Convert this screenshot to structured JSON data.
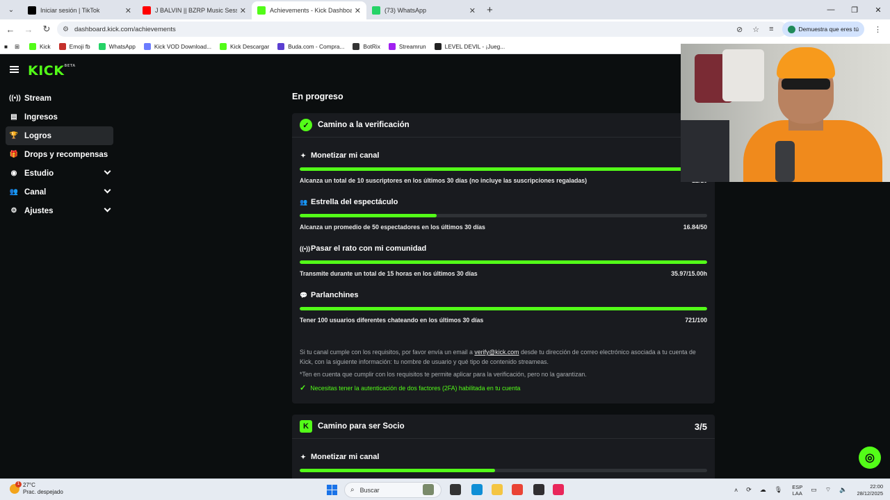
{
  "browser": {
    "tabs": [
      {
        "title": "Iniciar sesión | TikTok",
        "favicon_color": "#000000",
        "active": false
      },
      {
        "title": "J BALVIN || BZRP Music Session",
        "favicon_color": "#ff0000",
        "active": false
      },
      {
        "title": "Achievements - Kick Dashboard",
        "favicon_color": "#53fc18",
        "active": true
      },
      {
        "title": "(73) WhatsApp",
        "favicon_color": "#25d366",
        "active": false
      }
    ],
    "url": "dashboard.kick.com/achievements",
    "verify_chip": "Demuestra que eres tú",
    "bookmarks": [
      {
        "label": "Kick",
        "color": "#53fc18"
      },
      {
        "label": "Emoji fb",
        "color": "#c4302b"
      },
      {
        "label": "WhatsApp",
        "color": "#25d366"
      },
      {
        "label": "Kick VOD Download...",
        "color": "#6b7cff"
      },
      {
        "label": "Kick Descargar",
        "color": "#53fc18"
      },
      {
        "label": "Buda.com - Compra...",
        "color": "#5b3fd1"
      },
      {
        "label": "BotRix",
        "color": "#333333"
      },
      {
        "label": "Streamrun",
        "color": "#a020f0"
      },
      {
        "label": "LEVEL DEVIL - ¡Jueg...",
        "color": "#222222"
      }
    ]
  },
  "app": {
    "logo": "KICK",
    "logo_sup": "BETA",
    "nav": [
      {
        "label": "Stream",
        "icon": "stream-icon",
        "glyph": "((•))",
        "active": false,
        "has_chevron": false
      },
      {
        "label": "Ingresos",
        "icon": "income-icon",
        "glyph": "▤",
        "active": false,
        "has_chevron": false
      },
      {
        "label": "Logros",
        "icon": "trophy-icon",
        "glyph": "🏆",
        "active": true,
        "has_chevron": false
      },
      {
        "label": "Drops y recompensas",
        "icon": "gift-icon",
        "glyph": "🎁",
        "active": false,
        "has_chevron": false
      },
      {
        "label": "Estudio",
        "icon": "studio-icon",
        "glyph": "◉",
        "active": false,
        "has_chevron": true
      },
      {
        "label": "Canal",
        "icon": "channel-icon",
        "glyph": "👥",
        "active": false,
        "has_chevron": true
      },
      {
        "label": "Ajustes",
        "icon": "settings-icon",
        "glyph": "⚙",
        "active": false,
        "has_chevron": true
      }
    ],
    "section_title": "En progreso",
    "verification": {
      "title": "Camino a la verificación",
      "requirements": [
        {
          "title": "Monetizar mi canal",
          "icon": "sparkle-icon",
          "glyph": "✦",
          "desc": "Alcanza un total de 10 suscriptores en los últimos 30 días (no incluye las suscripciones regaladas)",
          "value": "12/10",
          "progress": 1.0
        },
        {
          "title": "Estrella del espectáculo",
          "icon": "viewers-icon",
          "glyph": "👥",
          "desc": "Alcanza un promedio de 50 espectadores en los últimos 30 días",
          "value": "16.84/50",
          "progress": 0.3368
        },
        {
          "title": "Pasar el rato con mi comunidad",
          "icon": "broadcast-icon",
          "glyph": "((•))",
          "desc": "Transmite durante un total de 15 horas en los últimos 30 días",
          "value": "35.97/15.00h",
          "progress": 1.0
        },
        {
          "title": "Parlanchines",
          "icon": "chat-icon",
          "glyph": "💬",
          "desc": "Tener 100 usuarios diferentes chateando en los últimos 30 días",
          "value": "721/100",
          "progress": 1.0
        }
      ],
      "info_before_email": "Si tu canal cumple con los requisitos, por favor envía un email a",
      "email": "verify@kick.com",
      "info_after_email": "desde tu dirección de correo electrónico asociada a tu cuenta de Kick, con la siguiente información: tu nombre de usuario y qué tipo de contenido streameas.",
      "note": "*Ten en cuenta que cumplir con los requisitos te permite aplicar para la verificación, pero no la garantizan.",
      "twofa": "Necesitas tener la autenticación de dos factores (2FA) habilitada en tu cuenta"
    },
    "partner": {
      "title": "Camino para ser Socio",
      "count": "3/5",
      "requirements": [
        {
          "title": "Monetizar mi canal",
          "icon": "sparkle-icon",
          "glyph": "✦",
          "progress": 0.48
        }
      ]
    }
  },
  "taskbar": {
    "weather_temp": "27°C",
    "weather_desc": "Prac. despejado",
    "notification_count": "1",
    "search_placeholder": "Buscar",
    "lang_top": "ESP",
    "lang_bottom": "LAA",
    "time": "22:00",
    "date": "28/12/2025",
    "apps": [
      {
        "name": "gallery-app-icon",
        "color": "#7a8a6a"
      },
      {
        "name": "files-app-icon",
        "color": "#333333"
      },
      {
        "name": "edge-app-icon",
        "color": "#0f8fd6"
      },
      {
        "name": "explorer-app-icon",
        "color": "#f4c542"
      },
      {
        "name": "chrome-app-icon",
        "color": "#ea4335"
      },
      {
        "name": "obs-app-icon",
        "color": "#302e31"
      },
      {
        "name": "tiktok-app-icon",
        "color": "#e9265a"
      }
    ]
  }
}
